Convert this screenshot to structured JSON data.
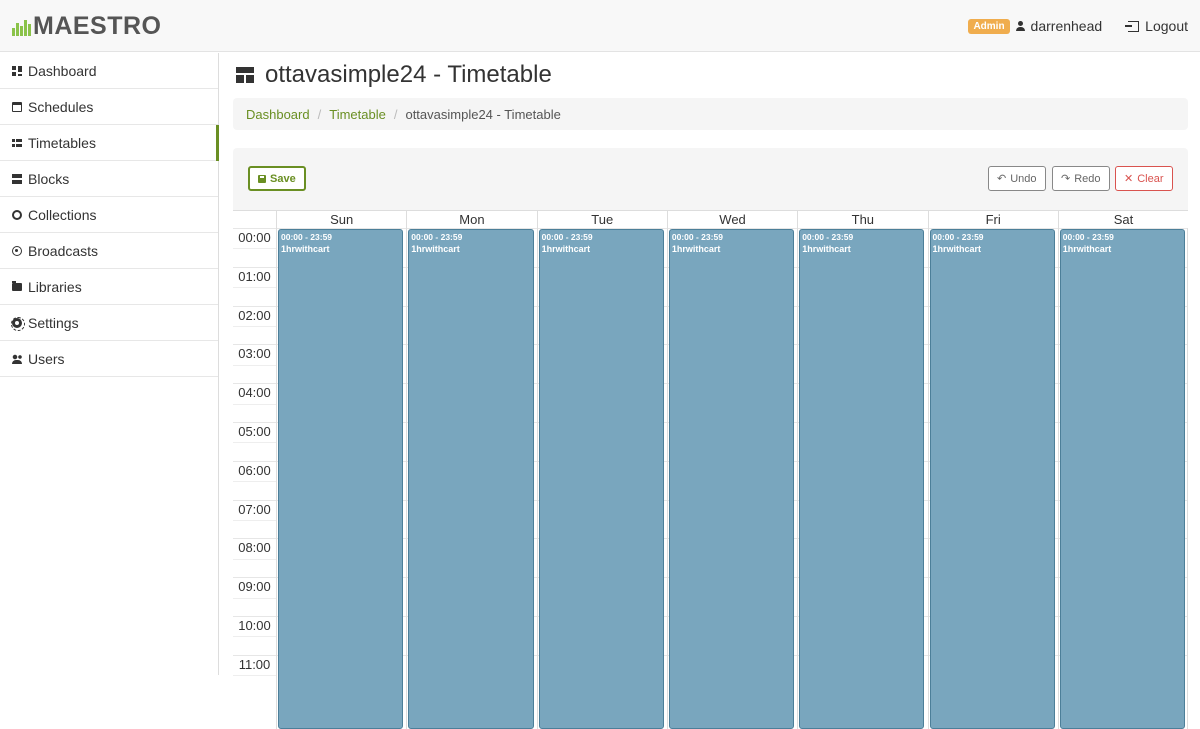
{
  "brand": {
    "name": "MAESTRO",
    "accent": "#8bc34a"
  },
  "user": {
    "role_badge": "Admin",
    "username": "darrenhead",
    "logout_label": "Logout"
  },
  "sidebar": {
    "items": [
      {
        "label": "Dashboard",
        "icon": "dashboard-icon"
      },
      {
        "label": "Schedules",
        "icon": "calendar-icon"
      },
      {
        "label": "Timetables",
        "icon": "grid-icon",
        "active": true
      },
      {
        "label": "Blocks",
        "icon": "blocks-icon"
      },
      {
        "label": "Collections",
        "icon": "collections-icon"
      },
      {
        "label": "Broadcasts",
        "icon": "broadcast-icon"
      },
      {
        "label": "Libraries",
        "icon": "folder-icon"
      },
      {
        "label": "Settings",
        "icon": "gear-icon"
      },
      {
        "label": "Users",
        "icon": "users-icon"
      }
    ]
  },
  "page": {
    "title": "ottavasimple24 - Timetable"
  },
  "breadcrumb": {
    "items": [
      "Dashboard",
      "Timetable",
      "ottavasimple24 - Timetable"
    ]
  },
  "toolbar": {
    "save_label": "Save",
    "undo_label": "Undo",
    "redo_label": "Redo",
    "clear_label": "Clear"
  },
  "timetable": {
    "days": [
      "Sun",
      "Mon",
      "Tue",
      "Wed",
      "Thu",
      "Fri",
      "Sat"
    ],
    "hours": [
      "00:00",
      "01:00",
      "02:00",
      "03:00",
      "04:00",
      "05:00",
      "06:00",
      "07:00",
      "08:00",
      "09:00",
      "10:00",
      "11:00"
    ],
    "events": [
      {
        "day": "Sun",
        "time": "00:00 - 23:59",
        "name": "1hrwithcart"
      },
      {
        "day": "Mon",
        "time": "00:00 - 23:59",
        "name": "1hrwithcart"
      },
      {
        "day": "Tue",
        "time": "00:00 - 23:59",
        "name": "1hrwithcart"
      },
      {
        "day": "Wed",
        "time": "00:00 - 23:59",
        "name": "1hrwithcart"
      },
      {
        "day": "Thu",
        "time": "00:00 - 23:59",
        "name": "1hrwithcart"
      },
      {
        "day": "Fri",
        "time": "00:00 - 23:59",
        "name": "1hrwithcart"
      },
      {
        "day": "Sat",
        "time": "00:00 - 23:59",
        "name": "1hrwithcart"
      }
    ],
    "event_color": "#79a6be"
  }
}
